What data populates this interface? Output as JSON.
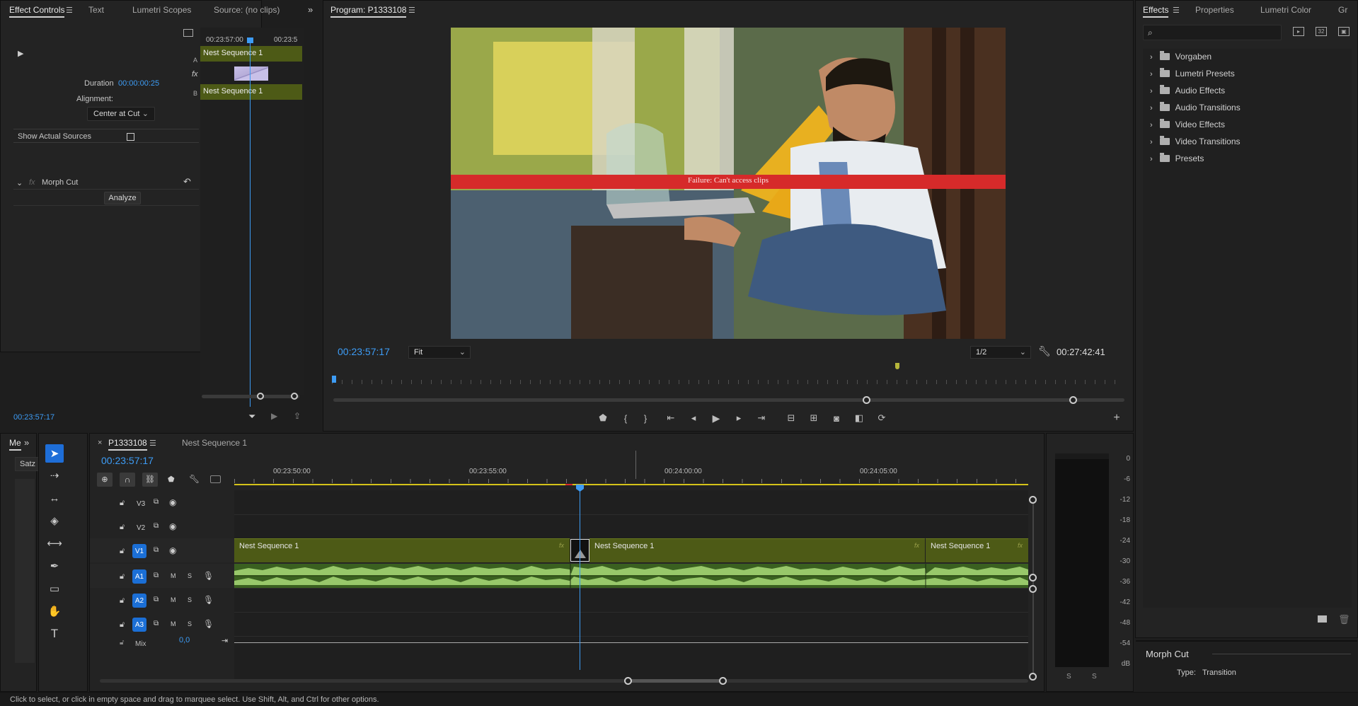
{
  "effect_controls": {
    "tabs": [
      "Effect Controls",
      "Text",
      "Lumetri Scopes",
      "Source: (no clips)"
    ],
    "mini_ruler": [
      "00:23:57:00",
      "00:23:5"
    ],
    "track_a": "A",
    "track_b": "B",
    "fx_label": "fx",
    "clip_a": "Nest Sequence 1",
    "clip_b": "Nest Sequence 1",
    "duration_label": "Duration",
    "duration_value": "00:00:00:25",
    "alignment_label": "Alignment:",
    "alignment_value": "Center at Cut",
    "show_sources_label": "Show Actual Sources",
    "effect_name": "Morph Cut",
    "analyze_label": "Analyze",
    "timecode": "00:23:57:17"
  },
  "program": {
    "title": "Program: P1333108",
    "error_message": "Failure: Can't access clips",
    "timecode": "00:23:57:17",
    "fit": "Fit",
    "resolution": "1/2",
    "duration": "00:27:42:41"
  },
  "effects": {
    "tabs": [
      "Effects",
      "Properties",
      "Lumetri Color",
      "Gr"
    ],
    "tree": [
      "Vorgaben",
      "Lumetri Presets",
      "Audio Effects",
      "Audio Transitions",
      "Video Effects",
      "Video Transitions",
      "Presets"
    ],
    "info_title": "Morph Cut",
    "info_type_label": "Type:",
    "info_type_value": "Transition"
  },
  "project": {
    "tab": "Me",
    "field": "Satz"
  },
  "timeline": {
    "tabs": [
      "P1333108",
      "Nest Sequence 1"
    ],
    "timecode": "00:23:57:17",
    "ruler": [
      "00:23:50:00",
      "00:23:55:00",
      "00:24:00:00",
      "00:24:05:00"
    ],
    "tracks": {
      "v3": "V3",
      "v2": "V2",
      "v1": "V1",
      "a1": "A1",
      "a2": "A2",
      "a3": "A3",
      "mix": "Mix",
      "mix_value": "0,0"
    },
    "m_label": "M",
    "s_label": "S",
    "clips": [
      "Nest Sequence 1",
      "Nest Sequence 1",
      "Nest Sequence 1"
    ]
  },
  "meter": {
    "scale": [
      "0",
      "-6",
      "-12",
      "-18",
      "-24",
      "-30",
      "-36",
      "-42",
      "-48",
      "-54",
      "dB"
    ],
    "solo": [
      "S",
      "S"
    ]
  },
  "status_bar": "Click to select, or click in empty space and drag to marquee select. Use Shift, Alt, and Ctrl for other options.",
  "colors": {
    "accent": "#3d9cf5",
    "clip": "#4d5a16",
    "audio": "#7ba84a",
    "error": "#d62a2a"
  }
}
